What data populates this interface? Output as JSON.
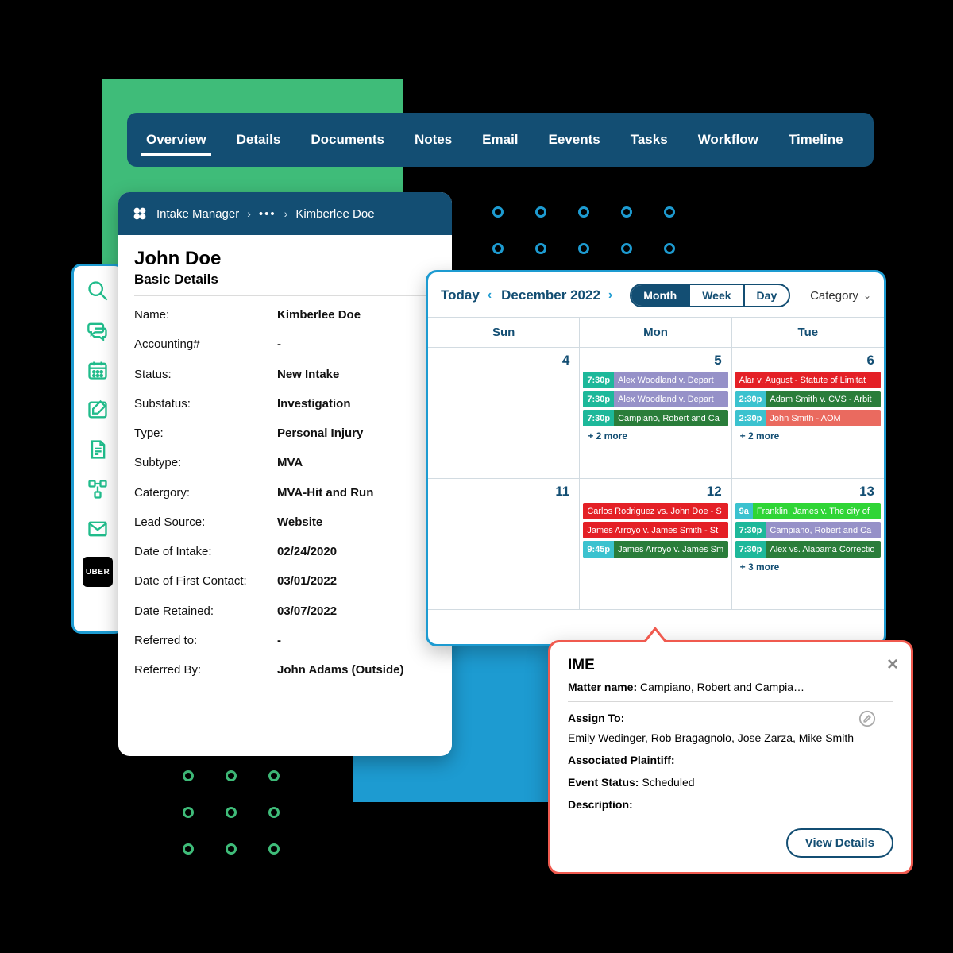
{
  "nav": {
    "tabs": [
      "Overview",
      "Details",
      "Documents",
      "Notes",
      "Email",
      "Eevents",
      "Tasks",
      "Workflow",
      "Timeline"
    ],
    "active": "Overview"
  },
  "rail": {
    "icons": [
      "search-icon",
      "chat-icon",
      "calendar-icon",
      "compose-icon",
      "document-icon",
      "workflow-icon",
      "mail-icon"
    ],
    "uber": "UBER"
  },
  "intake": {
    "header": {
      "title": "Intake Manager",
      "crumb": "Kimberlee Doe"
    },
    "name": "John Doe",
    "section": "Basic Details",
    "rows": [
      {
        "label": "Name:",
        "value": "Kimberlee Doe"
      },
      {
        "label": "Accounting#",
        "value": "-"
      },
      {
        "label": "Status:",
        "value": "New Intake"
      },
      {
        "label": "Substatus:",
        "value": "Investigation"
      },
      {
        "label": "Type:",
        "value": "Personal Injury"
      },
      {
        "label": "Subtype:",
        "value": "MVA"
      },
      {
        "label": "Catergory:",
        "value": "MVA-Hit and Run"
      },
      {
        "label": "Lead Source:",
        "value": "Website"
      },
      {
        "label": "Date of Intake:",
        "value": "02/24/2020"
      },
      {
        "label": "Date of First Contact:",
        "value": "03/01/2022"
      },
      {
        "label": "Date Retained:",
        "value": "03/07/2022"
      },
      {
        "label": "Referred to:",
        "value": "-"
      },
      {
        "label": "Referred By:",
        "value": "John Adams (Outside)"
      }
    ]
  },
  "calendar": {
    "today": "Today",
    "label": "December 2022",
    "views": [
      "Month",
      "Week",
      "Day"
    ],
    "activeView": "Month",
    "category": "Category",
    "dayHeaders": [
      "Sun",
      "Mon",
      "Tue"
    ],
    "weeks": [
      {
        "days": [
          {
            "num": "4",
            "events": [],
            "more": ""
          },
          {
            "num": "5",
            "events": [
              {
                "time": "7:30p",
                "tclass": "t-teal",
                "text": "Alex Woodland v. Depart",
                "bclass": "t-lav"
              },
              {
                "time": "7:30p",
                "tclass": "t-teal",
                "text": "Alex Woodland v. Depart",
                "bclass": "t-lav"
              },
              {
                "time": "7:30p",
                "tclass": "t-teal",
                "text": "Campiano, Robert and Ca",
                "bclass": "t-dgreen"
              }
            ],
            "more": "+ 2 more"
          },
          {
            "num": "6",
            "events": [
              {
                "time": "",
                "tclass": "",
                "text": "Alar v. August - Statute of Limitat",
                "bclass": "t-red"
              },
              {
                "time": "2:30p",
                "tclass": "t-cyan",
                "text": "Adam Smith v. CVS - Arbit",
                "bclass": "t-dgreen"
              },
              {
                "time": "2:30p",
                "tclass": "t-cyan",
                "text": "John Smith - AOM",
                "bclass": "t-salmon"
              }
            ],
            "more": "+ 2 more"
          }
        ]
      },
      {
        "days": [
          {
            "num": "11",
            "events": [],
            "more": ""
          },
          {
            "num": "12",
            "events": [
              {
                "time": "",
                "tclass": "",
                "text": "Carlos Rodriguez vs. John Doe - S",
                "bclass": "t-red"
              },
              {
                "time": "",
                "tclass": "",
                "text": "James Arroyo v. James Smith - St",
                "bclass": "t-red"
              },
              {
                "time": "9:45p",
                "tclass": "t-cyan",
                "text": "James Arroyo v. James Sm",
                "bclass": "t-dgreen"
              }
            ],
            "more": ""
          },
          {
            "num": "13",
            "events": [
              {
                "time": "9a",
                "tclass": "t-cyan",
                "text": "Franklin, James v. The city of",
                "bclass": "t-lime"
              },
              {
                "time": "7:30p",
                "tclass": "t-teal",
                "text": "Campiano, Robert and Ca",
                "bclass": "t-lav"
              },
              {
                "time": "7:30p",
                "tclass": "t-teal",
                "text": "Alex vs. Alabama Correctio",
                "bclass": "t-dgreen"
              }
            ],
            "more": "+ 3 more"
          }
        ]
      }
    ]
  },
  "popover": {
    "title": "IME",
    "matterLabel": "Matter name:",
    "matterValue": "Campiano, Robert and Campia…",
    "assignLabel": "Assign To:",
    "assignValue": "Emily Wedinger, Rob Bragagnolo, Jose Zarza, Mike Smith",
    "plaintiffLabel": "Associated Plaintiff:",
    "statusLabel": "Event Status:",
    "statusValue": "Scheduled",
    "descLabel": "Description:",
    "button": "View Details"
  }
}
